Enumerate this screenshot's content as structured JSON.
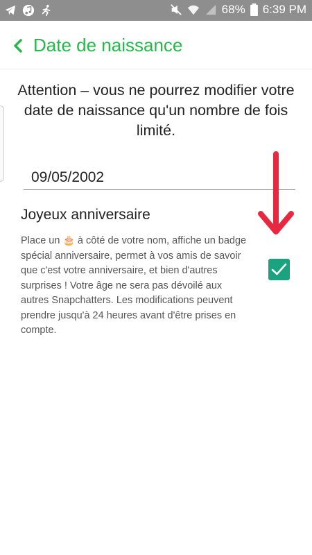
{
  "status_bar": {
    "left_icons": [
      "telegram-icon",
      "music-icon",
      "runner-icon"
    ],
    "right_icons": [
      "mute-icon",
      "wifi-icon",
      "signal-icon",
      "battery-icon"
    ],
    "battery": "68%",
    "time": "6:39 PM"
  },
  "header": {
    "back_icon": "chevron-left-icon",
    "title": "Date de naissance"
  },
  "warning": "Attention – vous ne pourrez modifier votre date de naissance qu'un nombre de fois limité.",
  "birthdate": {
    "value": "09/05/2002"
  },
  "birthday_section": {
    "title": "Joyeux anniversaire",
    "desc_before_icon": "Place un ",
    "icon": "cake-icon",
    "desc_after_icon": " à côté de votre nom, affiche un badge spécial anniversaire, permet à vos amis de savoir que c'est votre anniversaire, et bien d'autres surprises ! Votre âge ne sera pas dévoilé aux autres Snapchatters. Les modifications peuvent prendre jusqu'à 24 heures avant d'être prises en compte.",
    "checked": true
  },
  "colors": {
    "status_bar": "#8e8e8e",
    "title": "#26b84a",
    "checkbox": "#1aa37f",
    "arrow": "#e8283f"
  }
}
